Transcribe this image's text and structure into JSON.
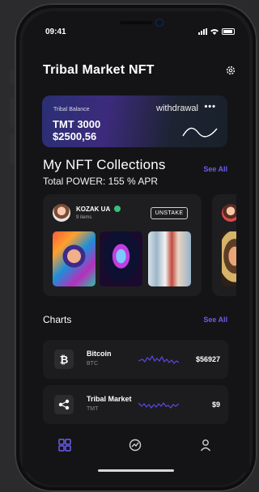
{
  "status": {
    "time": "09:41"
  },
  "header": {
    "title": "Tribal Market NFT"
  },
  "balance": {
    "label": "Tribal Balance",
    "withdraw_label": "withdrawal",
    "more_label": "•••",
    "tmt": "TMT 3000",
    "usd": "$2500,56"
  },
  "nft_section": {
    "title": "My NFT Collections",
    "see_all": "See All",
    "total_power": "Total POWER: 155 % APR",
    "collections": [
      {
        "name": "KOZAK UA",
        "items": "9 items",
        "action": "UNSTAKE"
      }
    ]
  },
  "charts_section": {
    "title": "Charts",
    "see_all": "See All",
    "rows": [
      {
        "icon": "bitcoin-icon",
        "glyph": "₿",
        "name": "Bitcoin",
        "symbol": "BTC",
        "price": "$56927"
      },
      {
        "icon": "tribal-market-icon",
        "glyph": "",
        "name": "Tribal Market",
        "symbol": "TMT",
        "price": "$9"
      }
    ]
  },
  "colors": {
    "accent": "#6b5df0",
    "background": "#141416",
    "card": "#1c1c1e"
  }
}
